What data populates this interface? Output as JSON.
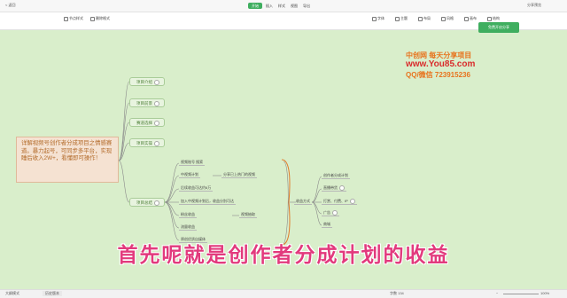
{
  "topbar": {
    "back": "< 返回",
    "tabs": [
      "开始",
      "插入",
      "样式",
      "视图",
      "导出"
    ],
    "active_tab": 0,
    "right_label": "分享预览"
  },
  "toolbar": {
    "left": [
      "节点样式",
      "删除格式"
    ],
    "right": [
      "字体",
      "主题",
      "布局",
      "风格",
      "画布",
      "结构"
    ]
  },
  "share_button": "免费开启分享",
  "mindmap": {
    "level1": [
      "项目介绍",
      "项目前景",
      "赛道选择",
      "项目实操",
      "项目总结"
    ],
    "level2": [
      "视频账号 搜索",
      "中视频计划",
      "后续收益可达约6万",
      "加入中视频计划后，收益分别可达",
      "粉丝收益",
      "流量收益",
      "原创优质自媒体"
    ],
    "level3": [
      "分享已上热门的视频",
      "视频抽取",
      "音乐背景"
    ],
    "branch_center": "收益方式",
    "right": [
      "创作者分成计划",
      "直播带货",
      "打赏、付费、IP",
      "广告",
      "商城"
    ]
  },
  "note": "详解视频号创作者分成项目之情感赛道。暴力起号，可同步多平台，实现睡后收入2W+，看懂即可操作！",
  "promo": {
    "line1": "中创网 每天分享项目",
    "line2": "www.You85.com",
    "line3": "QQ/微信 723915236"
  },
  "caption": "首先呢就是创作者分成计划的收益",
  "status": {
    "left": "大纲模式",
    "mid": "历史版本",
    "right": "字数 134",
    "zoom": "100%"
  },
  "colors": {
    "canvas": "#d9eecb",
    "node_fill": "#e8f4df",
    "accent": "#3fae5f",
    "note_fill": "#f5e2d2",
    "caption": "#e23a7d"
  }
}
